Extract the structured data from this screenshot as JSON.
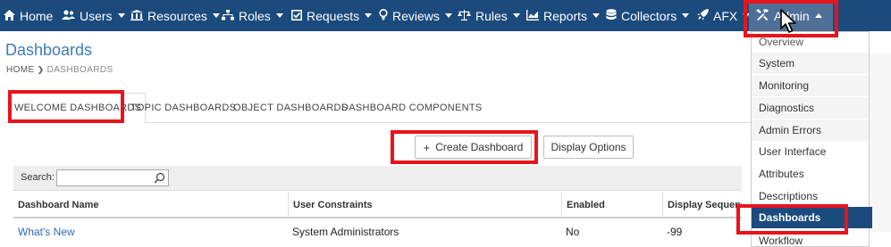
{
  "nav": {
    "items": [
      {
        "label": "Home",
        "icon": "home-icon"
      },
      {
        "label": "Users",
        "icon": "users-icon"
      },
      {
        "label": "Resources",
        "icon": "building-icon"
      },
      {
        "label": "Roles",
        "icon": "sitemap-icon"
      },
      {
        "label": "Requests",
        "icon": "checkbox-icon"
      },
      {
        "label": "Reviews",
        "icon": "bulb-icon"
      },
      {
        "label": "Rules",
        "icon": "scale-icon"
      },
      {
        "label": "Reports",
        "icon": "chart-icon"
      },
      {
        "label": "Collectors",
        "icon": "database-icon"
      },
      {
        "label": "AFX",
        "icon": "rocket-icon"
      },
      {
        "label": "Admin",
        "icon": "tools-icon"
      }
    ],
    "bar_color": "#1b4a7d",
    "active_color": "#4f6f96"
  },
  "page": {
    "title": "Dashboards",
    "breadcrumb": {
      "home": "HOME",
      "current": "DASHBOARDS"
    }
  },
  "tabs": [
    {
      "label": "WELCOME DASHBOARDS",
      "active": true
    },
    {
      "label": "TOPIC DASHBOARDS",
      "active": false
    },
    {
      "label": "OBJECT DASHBOARDS",
      "active": false
    },
    {
      "label": "DASHBOARD COMPONENTS",
      "active": false
    }
  ],
  "toolbar": {
    "create_label": "Create Dashboard",
    "display_options_label": "Display Options"
  },
  "search": {
    "label": "Search:",
    "value": ""
  },
  "table": {
    "columns": [
      "Dashboard Name",
      "User Constraints",
      "Enabled",
      "Display Sequence"
    ],
    "rows": [
      {
        "name": "What's New",
        "constraints": "System Administrators",
        "enabled": "No",
        "sequence": "-99"
      }
    ]
  },
  "admin_menu": {
    "items": [
      "Overview",
      "System",
      "Monitoring",
      "Diagnostics",
      "Admin Errors",
      "User Interface",
      "Attributes",
      "Descriptions",
      "Dashboards",
      "Workflow"
    ],
    "selected": "Dashboards"
  },
  "highlight_color": "#e8141b"
}
